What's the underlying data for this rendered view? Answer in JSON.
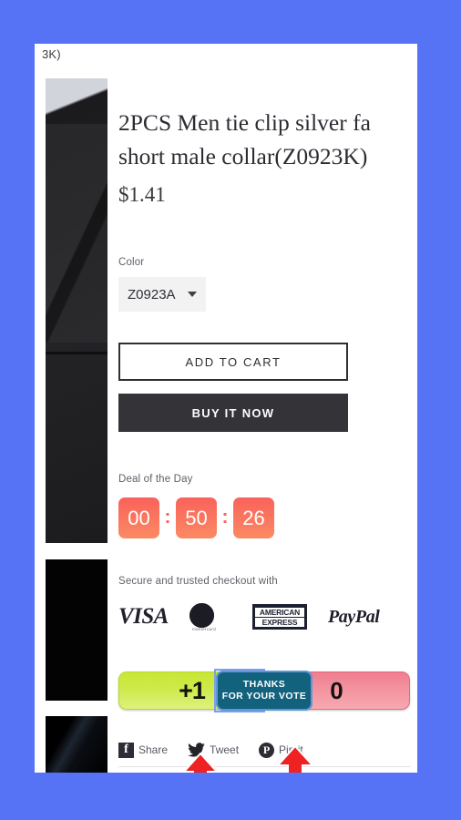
{
  "page": {
    "background_color": "#5672f5",
    "breadcrumb_tail": "3K)"
  },
  "product": {
    "title_line_1": "2PCS Men tie clip silver fa",
    "title_line_2": "short male collar(Z0923K)",
    "price": "$1.41",
    "gallery": [
      {
        "name": "product-photo-suit-lapel"
      },
      {
        "name": "product-photo-black"
      },
      {
        "name": "product-photo-silk"
      }
    ]
  },
  "options": {
    "color_label": "Color",
    "color_value": "Z0923A",
    "color_options": [
      "Z0923A"
    ]
  },
  "actions": {
    "add_to_cart_label": "ADD TO CART",
    "buy_now_label": "BUY IT NOW"
  },
  "deal": {
    "label": "Deal of the Day",
    "hours": "00",
    "minutes": "50",
    "seconds": "26",
    "separator": ":",
    "box_color_top": "#f9625b",
    "box_color_bottom": "#fb8a63"
  },
  "checkout": {
    "label": "Secure and trusted checkout with",
    "logos": [
      {
        "name": "visa-logo",
        "text": "VISA"
      },
      {
        "name": "mastercard-logo",
        "text": "mastercard"
      },
      {
        "name": "amex-logo",
        "line1": "AMERICAN",
        "line2": "EXPRESS"
      },
      {
        "name": "paypal-logo",
        "text": "PayPal"
      }
    ]
  },
  "vote": {
    "upvote_label": "+1",
    "count": "0",
    "tooltip_line_1": "THANKS",
    "tooltip_line_2": "FOR YOUR VOTE",
    "up_color": "#cdea4a",
    "count_color": "#f4939f",
    "tooltip_color": "#12617d"
  },
  "share": {
    "items": [
      {
        "name": "share-facebook",
        "label": "Share",
        "glyph": "f"
      },
      {
        "name": "share-twitter",
        "label": "Tweet"
      },
      {
        "name": "share-pinterest",
        "label": "Pin it",
        "glyph": "P"
      }
    ]
  },
  "annotations": {
    "arrow_color": "#ee2222",
    "arrow_1_target": "upvote-button",
    "arrow_2_target": "vote-tooltip"
  }
}
